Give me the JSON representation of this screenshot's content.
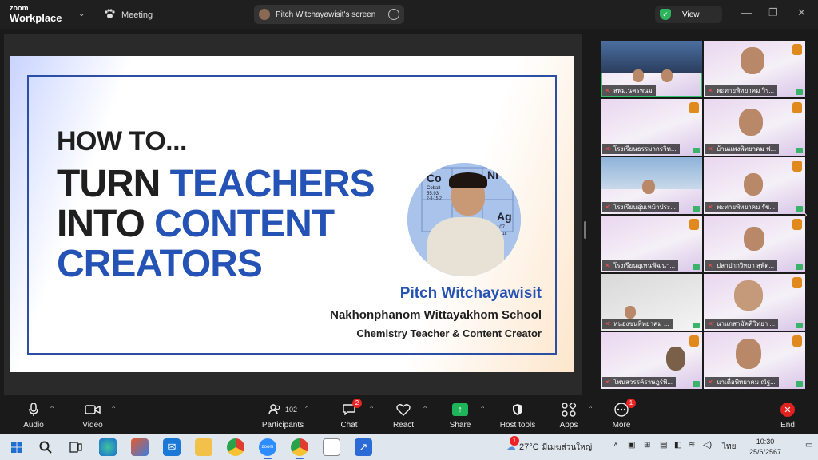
{
  "app": {
    "brand_top": "zoom",
    "brand_bottom": "Workplace",
    "meeting_label": "Meeting",
    "screen_label": "Pitch Witchayawisit's screen",
    "view_label": "View"
  },
  "slide": {
    "howto": "HOW TO...",
    "line1_dark": "TURN ",
    "line1_blue": "TEACHERS",
    "line2_dark": "INTO ",
    "line2_blue": "CONTENT",
    "line3_blue": "CREATORS",
    "presenter_name": "Pitch Witchayawisit",
    "school": "Nakhonphanom Wittayakhom School",
    "role": "Chemistry Teacher & Content Creator",
    "periodic": [
      {
        "sym": "Co",
        "name": "Cobalt",
        "num": "55.93",
        "cfg": "2-8-15-2"
      },
      {
        "sym": "Ni",
        "name": "",
        "num": "",
        "cfg": ""
      },
      {
        "sym": "Ag",
        "name": "",
        "num": "107",
        "cfg": "2-8-18"
      }
    ]
  },
  "gallery": {
    "tiles": [
      "สพม.นครพนม",
      "พะทายพิทยาคม วิร...",
      "โรงเรียนธรรมากรวิท...",
      "บ้านแพงพิทยาคม ฟ...",
      "โรงเรียนอุ่มเหม้าประ...",
      "พะทายพิทยาคม รัช...",
      "โรงเรียนอุเทนพัฒนา...",
      "ปลาปากวิทยา สุพัต...",
      "หนองซนพิทยาคม ...",
      "นาแกสามัคคีวิทยา ...",
      "โพนสวรรค์ราษฎร์พิ...",
      "นาเดื่อพิทยาคม ณัฐ..."
    ]
  },
  "toolbar": {
    "audio": "Audio",
    "video": "Video",
    "participants": "Participants",
    "participants_count": "102",
    "chat": "Chat",
    "chat_badge": "2",
    "react": "React",
    "share": "Share",
    "host_tools": "Host tools",
    "apps": "Apps",
    "more": "More",
    "more_badge": "1",
    "end": "End"
  },
  "taskbar": {
    "weather_temp": "27°C",
    "weather_desc": "มีเมฆส่วนใหญ่",
    "lang": "ไทย",
    "time": "10:30",
    "date": "25/6/2567",
    "weather_badge": "1"
  },
  "colors": {
    "accent_blue": "#2553b5",
    "share_green": "#1fb45a",
    "end_red": "#e0231f",
    "active_tile": "#31c36a"
  }
}
